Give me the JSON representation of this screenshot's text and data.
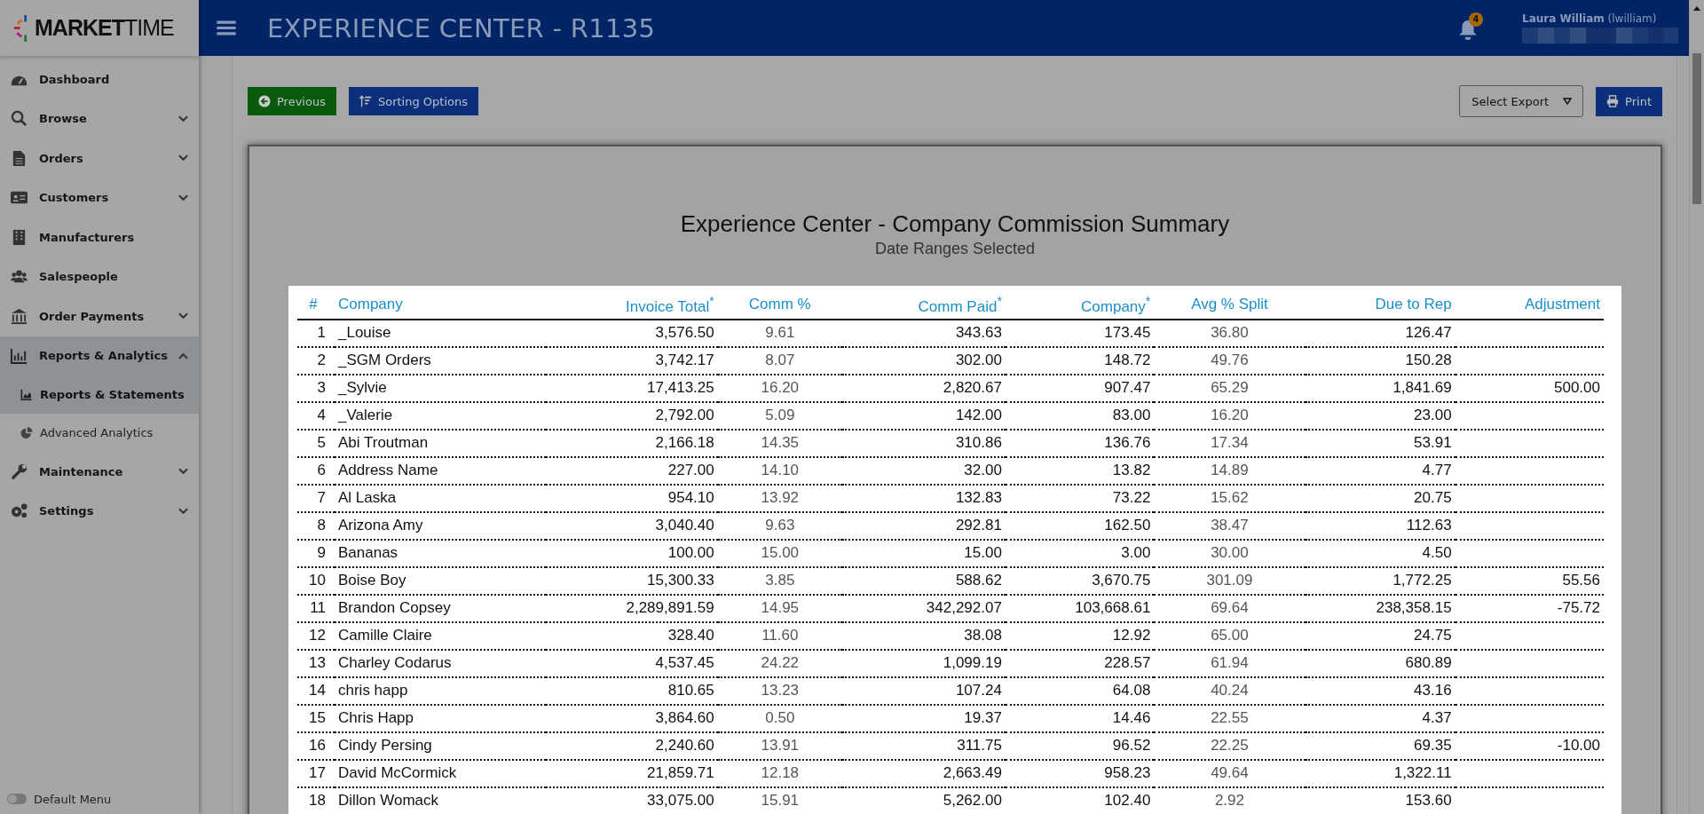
{
  "logo": {
    "text": "**MARKET**TIME"
  },
  "header": {
    "title": "EXPERIENCE CENTER - R1135",
    "notifications": "4",
    "user": "**Laura William** (lwilliam)"
  },
  "sidebar": {
    "items": [
      {
        "label": "Dashboard"
      },
      {
        "label": "Browse",
        "expanded": false
      },
      {
        "label": "Orders",
        "expanded": false
      },
      {
        "label": "Customers",
        "expanded": false
      },
      {
        "label": "Manufacturers"
      },
      {
        "label": "Salespeople"
      },
      {
        "label": "Order Payments",
        "expanded": false
      },
      {
        "label": "Reports & Analytics",
        "expanded": true,
        "children": [
          {
            "label": "Reports & Statements",
            "selected": true
          },
          {
            "label": "Advanced Analytics",
            "selected": false
          }
        ]
      },
      {
        "label": "Maintenance",
        "expanded": false
      },
      {
        "label": "Settings",
        "expanded": false
      }
    ],
    "default_menu": {
      "label": "Default Menu",
      "on": false
    }
  },
  "toolbar": {
    "previous": "Previous",
    "sorting": "Sorting Options",
    "export": "Select Export",
    "print": "Print"
  },
  "report": {
    "title": "Experience Center - Company Commission Summary",
    "subtitle": "Date Ranges Selected",
    "columns": [
      {
        "label": "#",
        "kind": "num"
      },
      {
        "label": "Company",
        "kind": "text"
      },
      {
        "label": "Invoice Total$^{*}$",
        "kind": "amount"
      },
      {
        "label": "Comm %",
        "kind": "percent"
      },
      {
        "label": "Comm Paid$^{*}$",
        "kind": "amount"
      },
      {
        "label": "Company$^{*}$",
        "kind": "amount"
      },
      {
        "label": "Avg % Split",
        "kind": "percent"
      },
      {
        "label": "Due to Rep",
        "kind": "amount"
      },
      {
        "label": "Adjustment",
        "kind": "amount"
      }
    ],
    "rows": [
      [
        "1",
        "_Louise",
        "3,576.50",
        "9.61",
        "343.63",
        "173.45",
        "36.80",
        "126.47"
      ],
      [
        "2",
        "_SGM Orders",
        "3,742.17",
        "8.07",
        "302.00",
        "148.72",
        "49.76",
        "150.28"
      ],
      [
        "3",
        "_Sylvie",
        "17,413.25",
        "16.20",
        "2,820.67",
        "907.47",
        "65.29",
        "1,841.69",
        "500.00"
      ],
      [
        "4",
        "_Valerie",
        "2,792.00",
        "5.09",
        "142.00",
        "83.00",
        "16.20",
        "23.00"
      ],
      [
        "5",
        "Abi Troutman",
        "2,166.18",
        "14.35",
        "310.86",
        "136.76",
        "17.34",
        "53.91"
      ],
      [
        "6",
        "Address Name",
        "227.00",
        "14.10",
        "32.00",
        "13.82",
        "14.89",
        "4.77"
      ],
      [
        "7",
        "Al Laska",
        "954.10",
        "13.92",
        "132.83",
        "73.22",
        "15.62",
        "20.75"
      ],
      [
        "8",
        "Arizona Amy",
        "3,040.40",
        "9.63",
        "292.81",
        "162.50",
        "38.47",
        "112.63"
      ],
      [
        "9",
        "Bananas",
        "100.00",
        "15.00",
        "15.00",
        "3.00",
        "30.00",
        "4.50"
      ],
      [
        "10",
        "Boise Boy",
        "15,300.33",
        "3.85",
        "588.62",
        "3,670.75",
        "301.09",
        "1,772.25",
        "55.56"
      ],
      [
        "11",
        "Brandon Copsey",
        "2,289,891.59",
        "14.95",
        "342,292.07",
        "103,668.61",
        "69.64",
        "238,358.15",
        "-75.72"
      ],
      [
        "12",
        "Camille Claire",
        "328.40",
        "11.60",
        "38.08",
        "12.92",
        "65.00",
        "24.75"
      ],
      [
        "13",
        "Charley Codarus",
        "4,537.45",
        "24.22",
        "1,099.19",
        "228.57",
        "61.94",
        "680.89"
      ],
      [
        "14",
        "chris happ",
        "810.65",
        "13.23",
        "107.24",
        "64.08",
        "40.24",
        "43.16"
      ],
      [
        "15",
        "Chris Happ",
        "3,864.60",
        "0.50",
        "19.37",
        "14.46",
        "22.55",
        "4.37"
      ],
      [
        "16",
        "Cindy Persing",
        "2,240.60",
        "13.91",
        "311.75",
        "96.52",
        "22.25",
        "69.35",
        "-10.00"
      ],
      [
        "17",
        "David McCormick",
        "21,859.71",
        "12.18",
        "2,663.49",
        "958.23",
        "49.64",
        "1,322.11"
      ],
      [
        "18",
        "Dillon Womack",
        "33,075.00",
        "15.91",
        "5,262.00",
        "102.40",
        "2.92",
        "153.60"
      ]
    ]
  }
}
